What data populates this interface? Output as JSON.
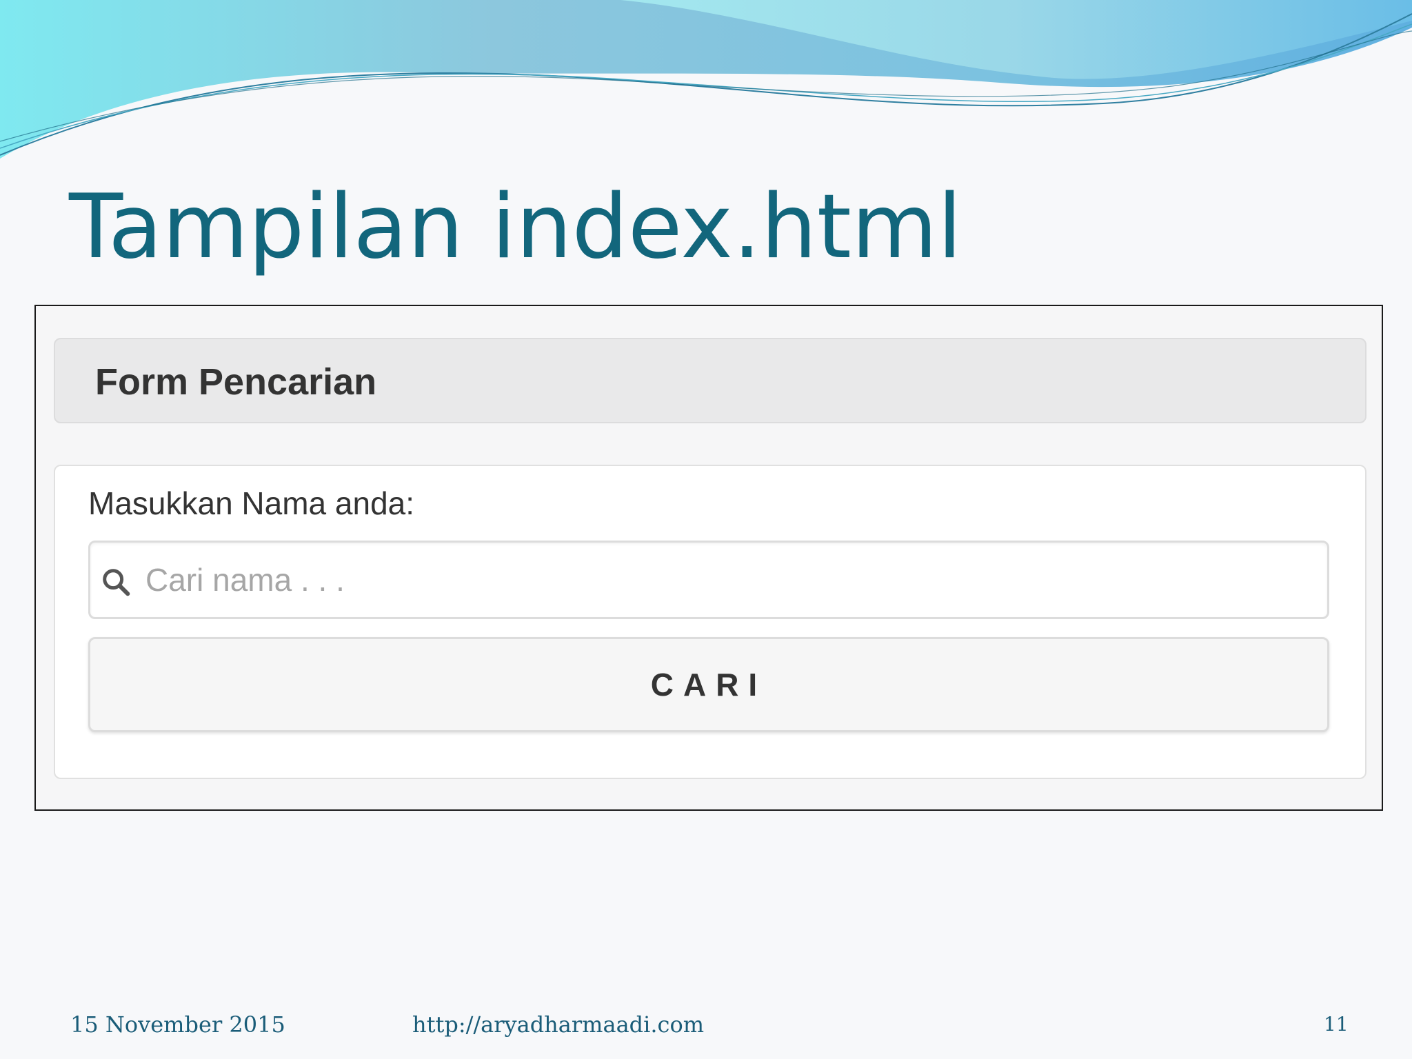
{
  "slide": {
    "title": "Tampilan index.html"
  },
  "form": {
    "header_title": "Form Pencarian",
    "label": "Masukkan Nama anda:",
    "search_placeholder": "Cari nama . . .",
    "search_value": "",
    "button_label": "CARI",
    "icon": "search-icon"
  },
  "footer": {
    "date": "15 November 2015",
    "url": "http://aryadharmaadi.com",
    "page": "11"
  },
  "colors": {
    "title": "#12667c",
    "wave_light": "#7ee8f0",
    "wave_blue": "#6fb8dc",
    "frame_border": "#1a1a1a"
  }
}
